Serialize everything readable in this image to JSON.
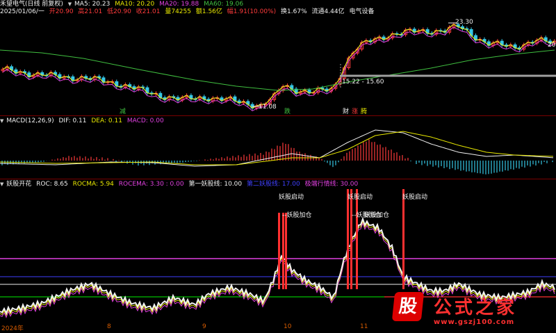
{
  "colors": {
    "bg": "#000000",
    "up": "#ff3b3b",
    "down": "#36c8e6",
    "ma5": "#f0f0f0",
    "ma10": "#e8e800",
    "ma20": "#e040e0",
    "ma60": "#40c040",
    "dif": "#f0f0f0",
    "dea": "#e8e800",
    "macd": "#e040e0",
    "red": "#ff3030",
    "blue": "#4040ff",
    "cyan": "#36c8e6",
    "green": "#00c000",
    "white": "#f0f0f0",
    "orange": "#d85c00",
    "grey": "#a0a0a0"
  },
  "main": {
    "title": "禾望电气(日线 前复权)",
    "ma5": "MA5: 20.23",
    "ma10": "MA10: 20.20",
    "ma20": "MA20: 19.88",
    "ma60": "MA60: 19.06",
    "date": "2025/01/06/一",
    "open": "开20.90",
    "high": "高21.01",
    "low": "低20.90",
    "close": "收21.01",
    "volume": "量74255",
    "amount": "额1.56亿",
    "change": "幅1.91(10.00%)",
    "turnover": "换1.67%",
    "float": "流通4.44亿",
    "sector": "电气设备",
    "high_label": "23.30",
    "low_label": "11.08",
    "range_label": "15.22 - 15.60",
    "right_label": "20",
    "tags": {
      "jian": "减",
      "die": "跌",
      "cai": "财",
      "zhang": "涨",
      "teng": "腾"
    }
  },
  "macd": {
    "title": "MACD(12,26,9)",
    "dif": "DIF: 0.11",
    "dea": "DEA: 0.11",
    "macd": "MACD: 0.00"
  },
  "yao": {
    "title": "妖股开花",
    "roc": "ROC: 8.65",
    "rocma": "ROCMA: 5.94",
    "rocema": "ROCEMA: 3.30 : 0.00",
    "first": "第一妖股线: 10.00",
    "second": "第二妖股线: 17.00",
    "hot": "极端行情线: 30.00",
    "qidong1": "妖股启动",
    "qidong2": "妖股启动",
    "qidong3": "妖股启动",
    "jiacang1": "--妖股加仓",
    "jiacang2": "--妖股加仓",
    "jiacang3": "妖股加仓"
  },
  "axis": {
    "year": "2024年",
    "m8": "8",
    "m9": "9",
    "m10": "10",
    "m11": "11"
  },
  "watermark": {
    "badge": "股",
    "title": "公式之家",
    "url": "www.gszj100.com"
  }
}
